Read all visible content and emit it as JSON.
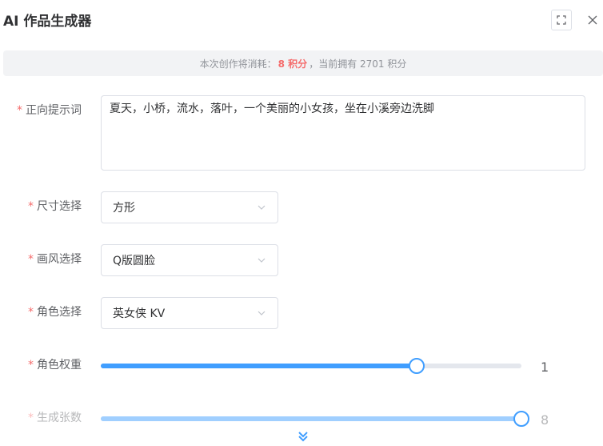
{
  "dialog": {
    "title": "AI 作品生成器",
    "fullscreen_icon": "fullscreen-icon",
    "close_icon": "close-icon"
  },
  "info": {
    "prefix": "本次创作将消耗：",
    "cost": "8 积分",
    "suffix": "，当前拥有 2701 积分"
  },
  "form": {
    "prompt": {
      "required": "*",
      "label": "正向提示词",
      "value": "夏天，小桥，流水，落叶，一个美丽的小女孩，坐在小溪旁边洗脚"
    },
    "size": {
      "required": "*",
      "label": "尺寸选择",
      "value": "方形"
    },
    "style": {
      "required": "*",
      "label": "画风选择",
      "value": "Q版圆脸"
    },
    "character": {
      "required": "*",
      "label": "角色选择",
      "value": "英女侠 KV"
    },
    "weight": {
      "required": "*",
      "label": "角色权重",
      "value": "1",
      "level": 0.75
    },
    "count": {
      "required": "*",
      "label": "生成张数",
      "value": "8",
      "level": 1.0
    }
  },
  "colors": {
    "accent": "#409eff",
    "required": "#f56c6c"
  },
  "footer": {
    "expand_icon": "double-chevron-down-icon"
  }
}
